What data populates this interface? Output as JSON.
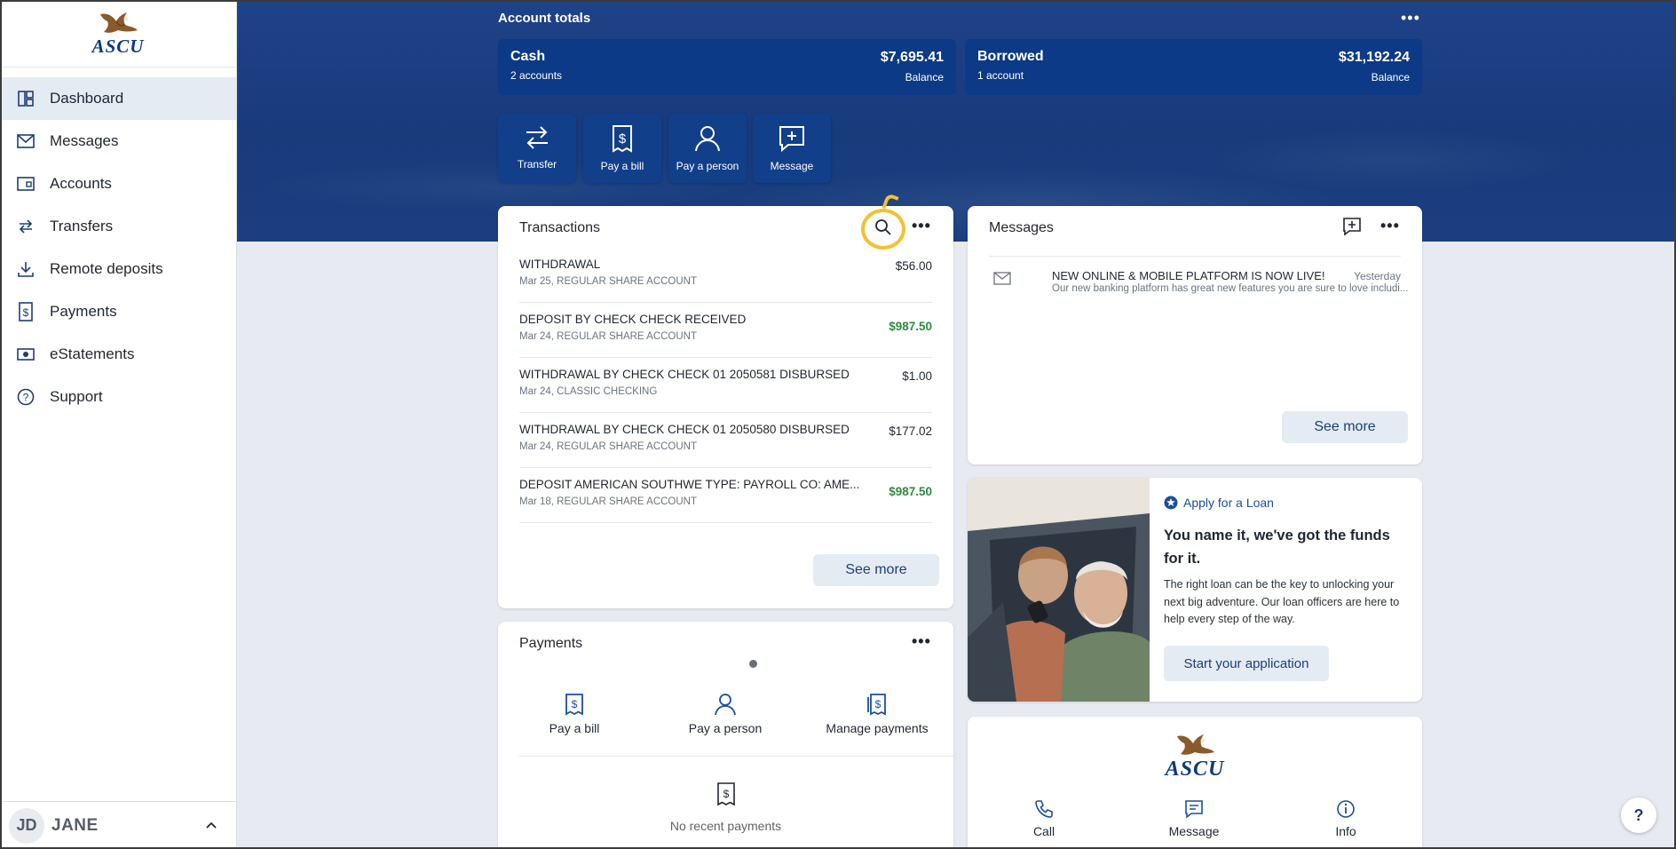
{
  "brand": {
    "name": "ASCU",
    "accent": "#0c3a86",
    "hero_bg": "#1f4288",
    "credit_color": "#2e8b3d",
    "highlight": "#f1c232"
  },
  "sidebar": {
    "items": [
      {
        "label": "Dashboard",
        "icon": "dashboard-icon"
      },
      {
        "label": "Messages",
        "icon": "envelope-icon"
      },
      {
        "label": "Accounts",
        "icon": "wallet-icon"
      },
      {
        "label": "Transfers",
        "icon": "transfer-arrows-icon"
      },
      {
        "label": "Remote deposits",
        "icon": "download-icon"
      },
      {
        "label": "Payments",
        "icon": "bill-icon"
      },
      {
        "label": "eStatements",
        "icon": "statement-icon"
      },
      {
        "label": "Support",
        "icon": "help-circle-icon"
      }
    ],
    "user": {
      "initials": "JD",
      "name": "JANE"
    }
  },
  "totals": {
    "title": "Account totals",
    "cash": {
      "name": "Cash",
      "sub": "2 accounts",
      "amount": "$7,695.41",
      "balance_label": "Balance"
    },
    "borrowed": {
      "name": "Borrowed",
      "sub": "1 account",
      "amount": "$31,192.24",
      "balance_label": "Balance"
    }
  },
  "quick_actions": [
    {
      "label": "Transfer"
    },
    {
      "label": "Pay a bill"
    },
    {
      "label": "Pay a person"
    },
    {
      "label": "Message"
    }
  ],
  "transactions": {
    "title": "Transactions",
    "rows": [
      {
        "desc": "WITHDRAWAL",
        "meta": "Mar 25, REGULAR SHARE ACCOUNT",
        "amount": "$56.00",
        "credit": false
      },
      {
        "desc": "DEPOSIT BY CHECK CHECK RECEIVED",
        "meta": "Mar 24, REGULAR SHARE ACCOUNT",
        "amount": "$987.50",
        "credit": true
      },
      {
        "desc": "WITHDRAWAL BY CHECK CHECK 01 2050581 DISBURSED",
        "meta": "Mar 24, CLASSIC CHECKING",
        "amount": "$1.00",
        "credit": false
      },
      {
        "desc": "WITHDRAWAL BY CHECK CHECK 01 2050580 DISBURSED",
        "meta": "Mar 24, REGULAR SHARE ACCOUNT",
        "amount": "$177.02",
        "credit": false
      },
      {
        "desc": "DEPOSIT AMERICAN SOUTHWE TYPE: PAYROLL CO: AME...",
        "meta": "Mar 18, REGULAR SHARE ACCOUNT",
        "amount": "$987.50",
        "credit": true
      }
    ],
    "see_more": "See more"
  },
  "payments": {
    "title": "Payments",
    "actions": [
      {
        "label": "Pay a bill"
      },
      {
        "label": "Pay a person"
      },
      {
        "label": "Manage payments"
      }
    ],
    "empty": "No recent payments"
  },
  "messages": {
    "title": "Messages",
    "items": [
      {
        "subject": "NEW ONLINE & MOBILE PLATFORM IS NOW LIVE!",
        "preview": "Our new banking platform has great new features you are sure to love includi...",
        "date": "Yesterday"
      }
    ],
    "see_more": "See more"
  },
  "promo": {
    "link": "Apply for a Loan",
    "headline": "You name it, we've got the funds for it.",
    "body": "The right loan can be the key to unlocking your next big adventure. Our loan officers are here to help every step of the way.",
    "cta": "Start your application"
  },
  "contact": {
    "logo_text": "ASCU",
    "actions": [
      {
        "label": "Call"
      },
      {
        "label": "Message"
      },
      {
        "label": "Info"
      }
    ]
  },
  "help_label": "?"
}
